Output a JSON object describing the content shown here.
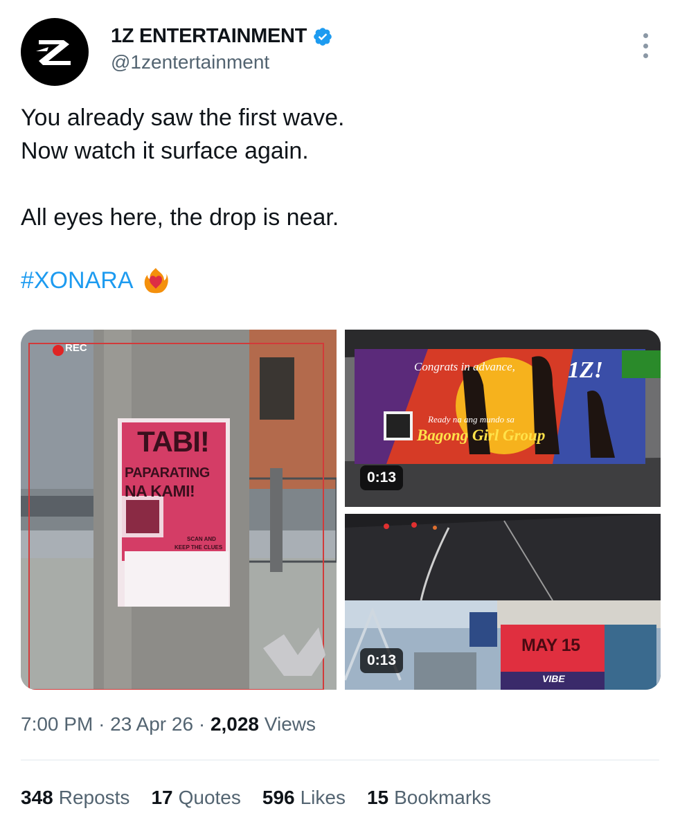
{
  "account": {
    "display_name": "1Z ENTERTAINMENT",
    "handle": "@1zentertainment",
    "verified": true,
    "verified_color": "#1d9bf0"
  },
  "tweet": {
    "lines": [
      "You already saw the first wave.",
      "Now watch it surface again.",
      "All eyes here, the drop is near."
    ],
    "hashtag": "#XONARA",
    "hashtag_color": "#1d9bf0",
    "emoji": "heart-on-fire"
  },
  "media": {
    "left": {
      "rec_label": "REC",
      "poster_title": "TABI!",
      "poster_line1": "PAPARATING",
      "poster_line2": "NA KAMI!",
      "poster_scan": "SCAN AND",
      "poster_keep": "KEEP THE CLUES"
    },
    "top_right": {
      "banner_top": "Congrats in advance,",
      "banner_brand": "1Z!",
      "banner_ready": "Ready na ang mundo sa",
      "banner_main": "Bagong Girl Group",
      "duration": "0:13"
    },
    "bottom_right": {
      "billboard": "MAY 15",
      "sign": "VIBE",
      "duration": "0:13"
    }
  },
  "meta": {
    "time": "7:00 PM",
    "date": "23 Apr 26",
    "views_count": "2,028",
    "views_label": "Views"
  },
  "stats": [
    {
      "count": "348",
      "label": "Reposts"
    },
    {
      "count": "17",
      "label": "Quotes"
    },
    {
      "count": "596",
      "label": "Likes"
    },
    {
      "count": "15",
      "label": "Bookmarks"
    }
  ]
}
